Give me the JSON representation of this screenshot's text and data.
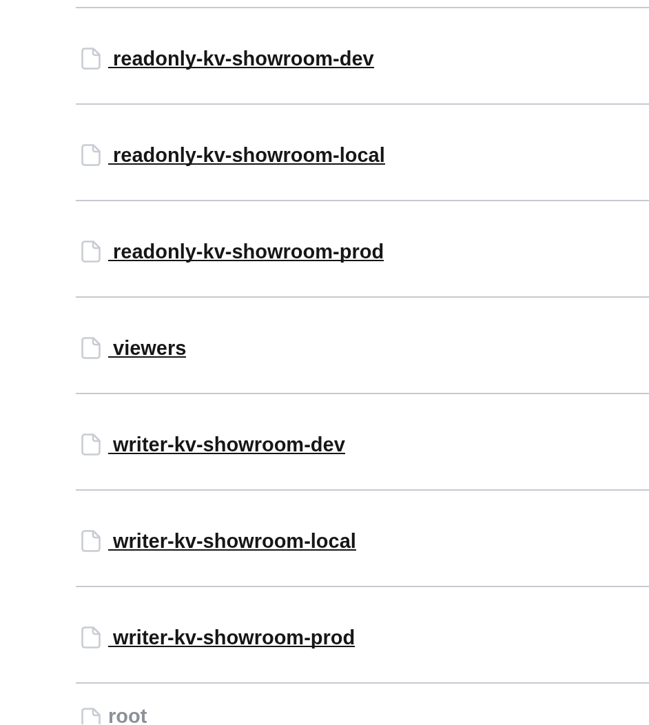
{
  "files": [
    {
      "name": "readonly-kv-showroom-dev",
      "disabled": false
    },
    {
      "name": "readonly-kv-showroom-local",
      "disabled": false
    },
    {
      "name": "readonly-kv-showroom-prod",
      "disabled": false
    },
    {
      "name": "viewers",
      "disabled": false
    },
    {
      "name": "writer-kv-showroom-dev",
      "disabled": false
    },
    {
      "name": "writer-kv-showroom-local",
      "disabled": false
    },
    {
      "name": "writer-kv-showroom-prod",
      "disabled": false
    },
    {
      "name": "root",
      "disabled": true
    }
  ]
}
